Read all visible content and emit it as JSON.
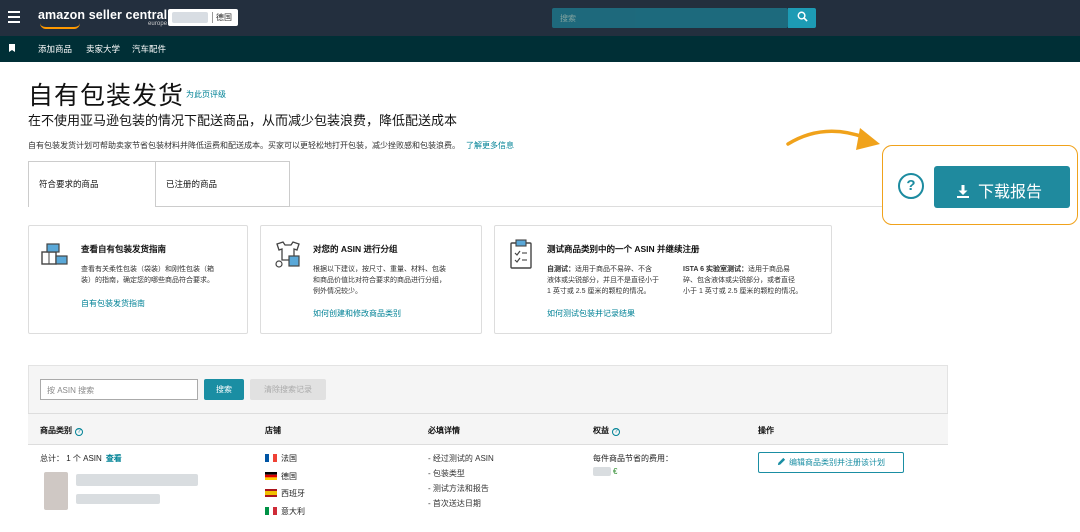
{
  "app": {
    "logo_text": "amazon seller central",
    "logo_sub": "europe",
    "store_label": "德国",
    "search_placeholder": "搜索"
  },
  "nav": {
    "links": [
      "添加商品",
      "卖家大学",
      "汽车配件"
    ]
  },
  "header": {
    "title": "自有包装发货",
    "learn_link": "为此页评级",
    "tagline": "在不使用亚马逊包装的情况下配送商品，从而减少包装浪费，降低配送成本",
    "description": "自有包装发货计划可帮助卖家节省包装材料并降低运费和配送成本。买家可以更轻松地打开包装，减少挫败感和包装浪费。",
    "description_link": "了解更多信息"
  },
  "tabs": [
    "符合要求的商品",
    "已注册的商品"
  ],
  "report": {
    "help_icon": "question-circle-icon",
    "download_label": "下载报告",
    "accent_color": "#f0a21b",
    "button_color": "#1f8a9e"
  },
  "cards": [
    {
      "title": "查看自有包装发货指南",
      "body": [
        "查看有关柔性包装（袋装）和刚性包装（箱",
        "装）的指南，确定您的哪些商品符合要求。"
      ],
      "link": "自有包装发货指南",
      "icon": "boxes-icon"
    },
    {
      "title": "对您的 ASIN 进行分组",
      "body": [
        "根据以下建议，按尺寸、重量、材料、包装",
        "和商品价值比对符合要求的商品进行分组，",
        "例外情况较少。"
      ],
      "link": "如何创建和修改商品类别",
      "icon": "items-icon"
    },
    {
      "title": "测试商品类别中的一个 ASIN 并继续注册",
      "body_left_title": "自测试：",
      "body_left": [
        "适用于商品不易碎、不含",
        "液体或尖锐部分，并且不是直径小于",
        "1 英寸或 2.5 厘米的颗粒的情况。"
      ],
      "body_right_title": "ISTA 6 实验室测试：",
      "body_right": [
        "适用于商品易",
        "碎、包含液体或尖锐部分，或者直径",
        "小于 1 英寸或 2.5 厘米的颗粒的情况。"
      ],
      "link": "如何测试包装并记录结果",
      "icon": "clipboard-icon"
    }
  ],
  "table": {
    "search_placeholder": "按 ASIN 搜索",
    "search_button": "搜索",
    "clear_button": "清除搜索记录",
    "headers": [
      "商品类别",
      "店铺",
      "必填详情",
      "权益",
      "操作"
    ],
    "total_label": "总计：",
    "total_value": "1 个 ASIN",
    "view_link": "查看",
    "stores": [
      {
        "name": "法国",
        "flag": [
          "#0055a4",
          "#ffffff",
          "#ef4135"
        ]
      },
      {
        "name": "德国",
        "flag": [
          "#000000",
          "#dd0000",
          "#ffce00"
        ]
      },
      {
        "name": "西班牙",
        "flag": [
          "#aa151b",
          "#f1bf00",
          "#aa151b"
        ]
      },
      {
        "name": "意大利",
        "flag": [
          "#009246",
          "#ffffff",
          "#ce2b37"
        ]
      }
    ],
    "details": [
      "- 经过测试的 ASIN",
      "- 包装类型",
      "- 测试方法和报告",
      "- 首次送达日期"
    ],
    "benefit_label": "每件商品节省的费用：",
    "benefit_currency": "€",
    "action_button": "编辑商品类别并注册该计划"
  }
}
